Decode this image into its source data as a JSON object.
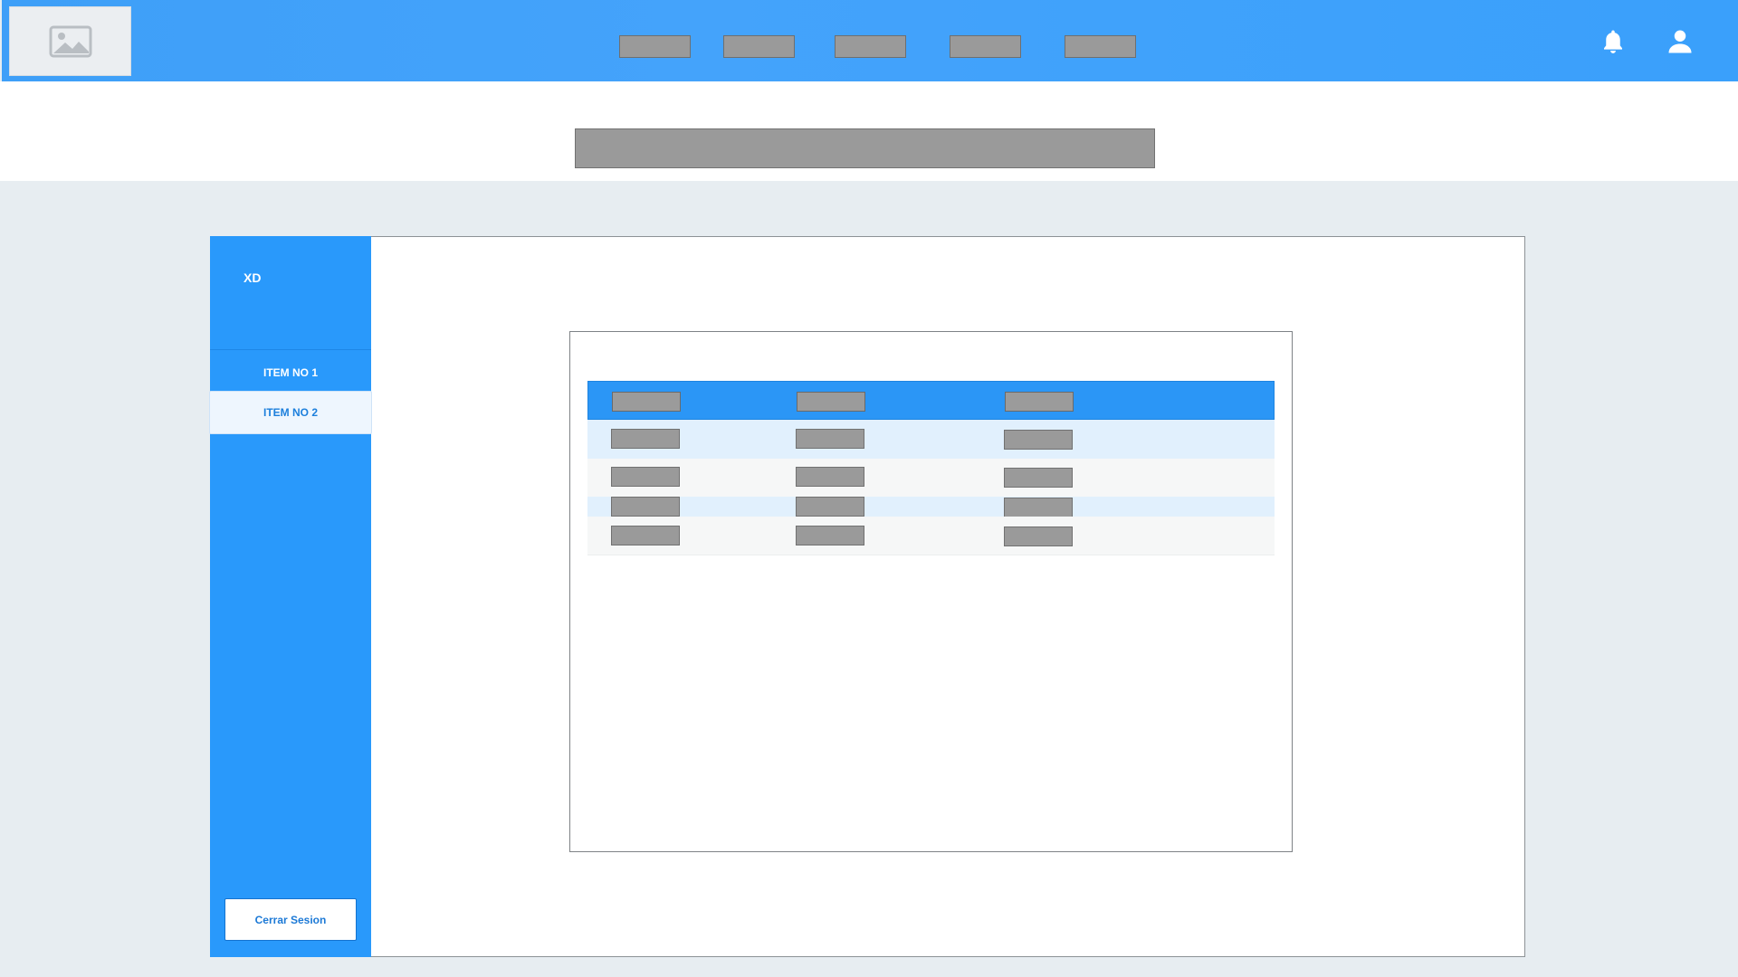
{
  "header": {
    "logo_icon": "image-placeholder-icon",
    "nav_items": [
      "",
      "",
      "",
      "",
      ""
    ],
    "notification_icon": "bell-icon",
    "profile_icon": "user-icon"
  },
  "page_title": "",
  "sidebar": {
    "brand": "XD",
    "items": [
      {
        "label": "ITEM NO 1",
        "active": false
      },
      {
        "label": "ITEM NO 2",
        "active": true
      }
    ],
    "logout_label": "Cerrar Sesion"
  },
  "table": {
    "headers": [
      "",
      "",
      ""
    ],
    "rows": [
      [
        "",
        "",
        ""
      ],
      [
        "",
        "",
        ""
      ],
      [
        "",
        "",
        ""
      ],
      [
        "",
        "",
        ""
      ]
    ]
  },
  "colors": {
    "primary": "#2999fb",
    "header_bar": "#3e9ff8",
    "placeholder": "#9a9a9a",
    "row_alt_blue": "#e3f1fe",
    "row_alt_gray": "#f7f8f8",
    "background": "#e7edf1"
  }
}
